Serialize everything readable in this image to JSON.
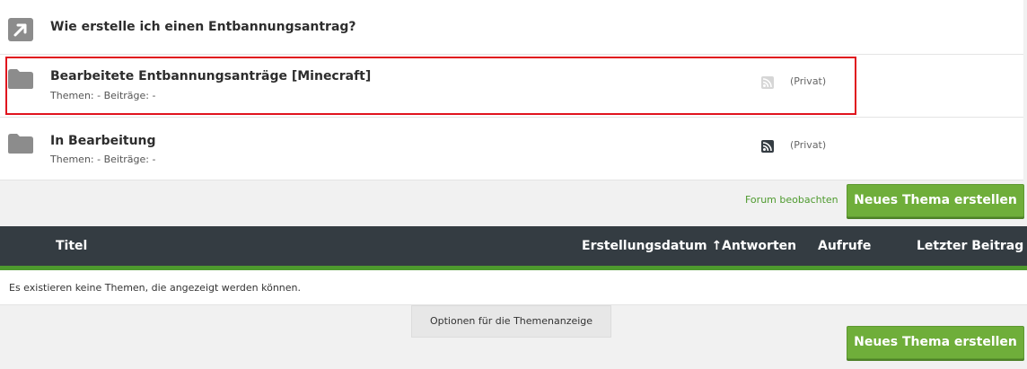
{
  "forums": [
    {
      "title": "Wie erstelle ich einen Entbannungsantrag?",
      "icon": "redirect-arrow-icon"
    },
    {
      "title": "Bearbeitete Entbannungsanträge [Minecraft]",
      "meta": "Themen: - Beiträge: -",
      "private": "(Privat)",
      "icon": "folder-icon",
      "rss": "rss-icon-faded"
    },
    {
      "title": "In Bearbeitung",
      "meta": "Themen: - Beiträge: -",
      "private": "(Privat)",
      "icon": "folder-icon",
      "rss": "rss-icon"
    }
  ],
  "actions": {
    "watch_label": "Forum beobachten",
    "new_thread_label": "Neues Thema erstellen"
  },
  "table": {
    "columns": [
      "Titel",
      "Erstellungsdatum ↑",
      "Antworten",
      "Aufrufe",
      "Letzter Beitrag"
    ],
    "empty_message": "Es existieren keine Themen, die angezeigt werden können."
  },
  "footer": {
    "options_label": "Optionen für die Themenanzeige",
    "new_thread_label": "Neues Thema erstellen"
  },
  "colors": {
    "accent_green": "#6fae3a",
    "header_dark": "#343c42",
    "highlight_red": "#e0141e"
  }
}
